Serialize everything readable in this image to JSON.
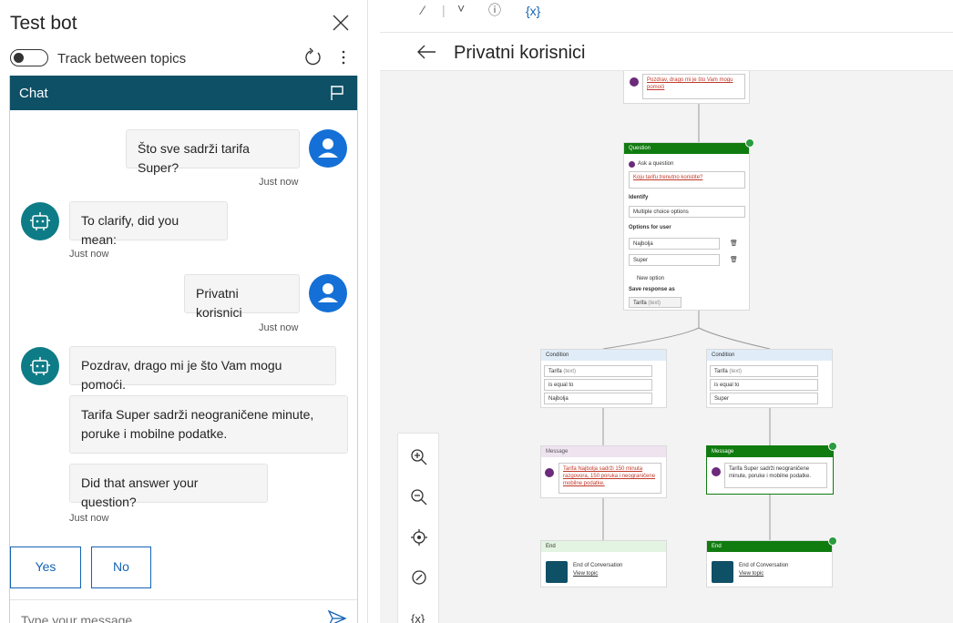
{
  "test_panel": {
    "title": "Test bot",
    "track_label": "Track between topics",
    "icons": {
      "close": "close-icon",
      "refresh": "refresh-icon",
      "more": "more-icon",
      "flag": "flag-icon",
      "send": "send-icon"
    }
  },
  "chat": {
    "header": "Chat",
    "messages": [
      {
        "sender": "user",
        "text": "Što sve sadrži tarifa Super?",
        "timestamp": "Just now"
      },
      {
        "sender": "bot",
        "text": "To clarify, did you mean:",
        "timestamp": "Just now"
      },
      {
        "sender": "user",
        "text": "Privatni korisnici",
        "timestamp": "Just now"
      },
      {
        "sender": "bot",
        "text": "Pozdrav, drago mi je što Vam mogu pomoći."
      },
      {
        "sender": "bot",
        "text": "Tarifa Super sadrži neograničene minute, poruke i mobilne podatke."
      },
      {
        "sender": "bot",
        "text": "Did that answer your question?",
        "timestamp": "Just now"
      }
    ],
    "quick_replies": [
      "Yes",
      "No"
    ],
    "input_placeholder": "Type your message"
  },
  "canvas": {
    "toolbar_glyphs": [
      "⁄",
      "|",
      "˅",
      "ⓘ",
      "{x}"
    ],
    "page_title": "Privatni korisnici",
    "top_message": "Pozdrav, drago mi je što Vam mogu pomoći",
    "question": {
      "header": "Question",
      "ask_label": "Ask a question",
      "ask_text": "Koju tarifu trenutno koristite?",
      "identify_label": "Identify",
      "identify_value": "Multiple choice options",
      "options_label": "Options for user",
      "options": [
        "Najbolja",
        "Super"
      ],
      "new_option": "New option",
      "save_label": "Save response as",
      "variable": "Tarifa",
      "variable_type": "(text)"
    },
    "conditions": [
      {
        "header": "Condition",
        "variable": "Tarifa",
        "variable_type": "(text)",
        "operator": "is equal to",
        "value": "Najbolja"
      },
      {
        "header": "Condition",
        "variable": "Tarifa",
        "variable_type": "(text)",
        "operator": "is equal to",
        "value": "Super"
      }
    ],
    "messages": [
      {
        "header": "Message",
        "text": "Tarifa Najbolja sadrži 150 minuta razgovora, 150 poruka i neograničene mobilne podatke."
      },
      {
        "header": "Message",
        "text": "Tarifa Super sadrži neograničene minute, poruke i mobilne podatke."
      }
    ],
    "ends": [
      {
        "header": "End",
        "title": "End of Conversation",
        "link": "View topic"
      },
      {
        "header": "End",
        "title": "End of Conversation",
        "link": "View topic"
      }
    ],
    "zoom_var_label": "{x}",
    "colors": {
      "header_green": "#107c10",
      "chat_header": "#0e5066",
      "user_avatar": "#1470d6",
      "bot_avatar": "#0e7c86"
    }
  }
}
